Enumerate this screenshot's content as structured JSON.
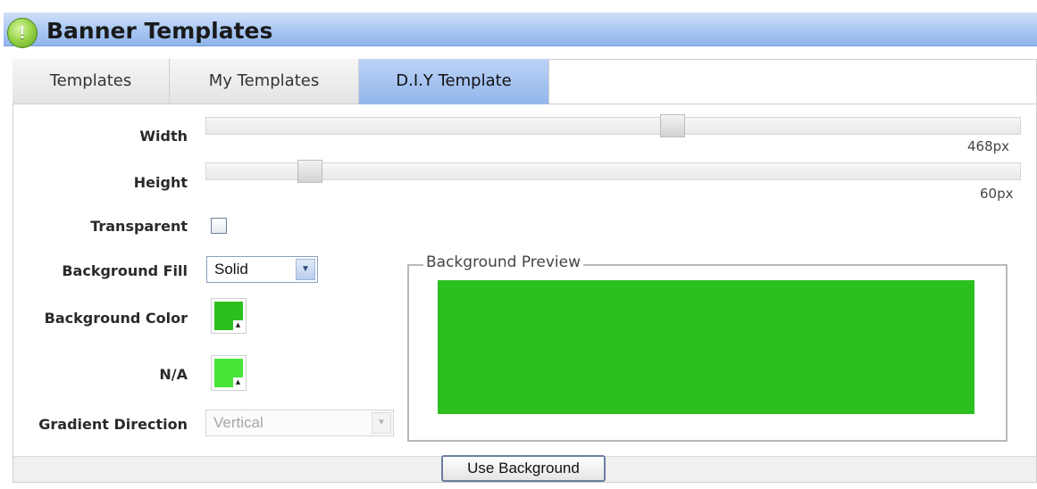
{
  "header": {
    "title": "Banner Templates",
    "icon": "app-logo-icon",
    "icon_glyph": "!"
  },
  "tabs": [
    {
      "label": "Templates",
      "active": false
    },
    {
      "label": "My Templates",
      "active": false
    },
    {
      "label": "D.I.Y Template",
      "active": true
    }
  ],
  "form": {
    "width": {
      "label": "Width",
      "value": "468px",
      "level": 0.575
    },
    "height": {
      "label": "Height",
      "value": "60px",
      "level": 0.115
    },
    "transparent": {
      "label": "Transparent",
      "checked": false
    },
    "background_fill": {
      "label": "Background Fill",
      "selected": "Solid"
    },
    "background_color": {
      "label": "Background Color",
      "color": "#2cc01f"
    },
    "na": {
      "label": "N/A",
      "color": "#47e337"
    },
    "gradient_direction": {
      "label": "Gradient Direction",
      "selected": "Vertical",
      "disabled": true
    }
  },
  "preview": {
    "legend": "Background Preview",
    "color": "#2cc01f"
  },
  "actions": {
    "use_background": "Use Background"
  },
  "colors": {
    "accent_blue": "#a9c7f3",
    "preview_green": "#2cc01f"
  }
}
